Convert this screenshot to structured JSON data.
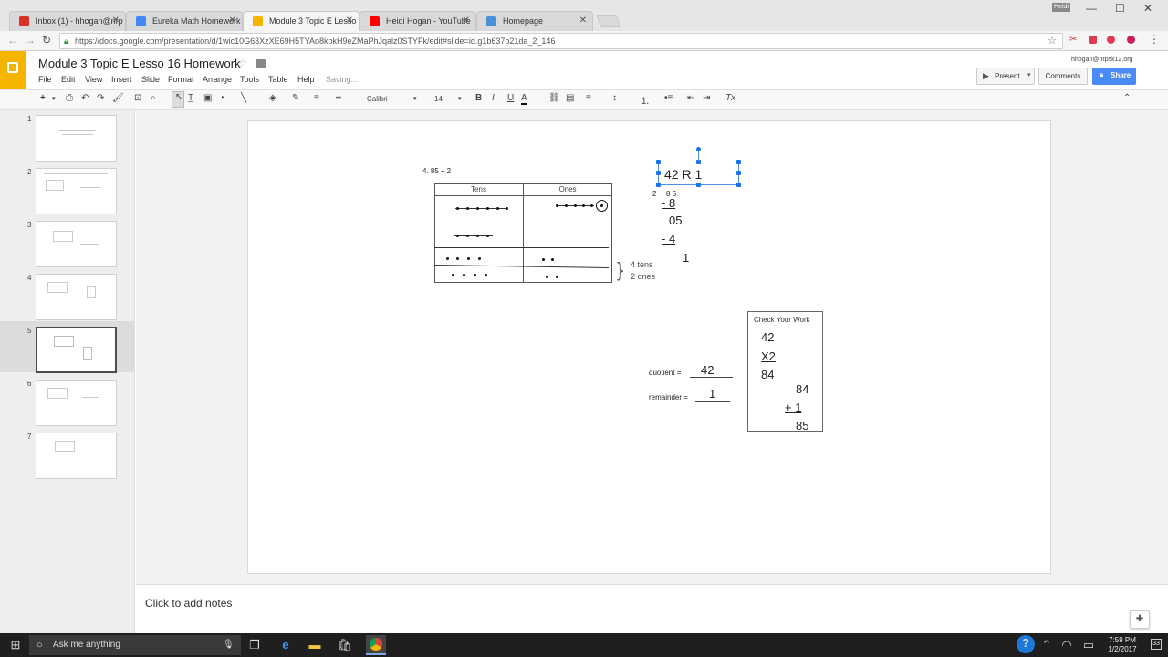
{
  "browser": {
    "tabs": [
      {
        "label": "Inbox (1) - hhogan@nrp",
        "color": "#d93025"
      },
      {
        "label": "Eureka Math Homework",
        "color": "#4285f4"
      },
      {
        "label": "Module 3 Topic E Lesso",
        "color": "#f4b400"
      },
      {
        "label": "Heidi Hogan - YouTube",
        "color": "#ff0000"
      },
      {
        "label": "Homepage",
        "color": "#4a90d9"
      }
    ],
    "profile_label": "Heidi",
    "url": "https://docs.google.com/presentation/d/1wic10G63XzXE69H5TYAo8kbkH9eZMaPhJqalz0STYFk/edit#slide=id.g1b637b21da_2_146"
  },
  "doc": {
    "title": "Module 3 Topic E Lesso 16 Homework",
    "menus": [
      "File",
      "Edit",
      "View",
      "Insert",
      "Slide",
      "Format",
      "Arrange",
      "Tools",
      "Table",
      "Help"
    ],
    "status": "Saving...",
    "account": "hhogan@nrpsk12.org",
    "present_label": "Present",
    "comments_label": "Comments",
    "share_label": "Share",
    "font_name": "Calibri",
    "font_size": "14"
  },
  "filmstrip": {
    "slides": [
      "1",
      "2",
      "3",
      "4",
      "5",
      "6",
      "7"
    ],
    "selected": "5"
  },
  "slide": {
    "problem": "4.    85 ÷ 2",
    "table_headers": {
      "tens": "Tens",
      "ones": "Ones"
    },
    "brace_lines": [
      "4 tens",
      "2 ones"
    ],
    "answer_box": "42 R 1",
    "division_divisor": "2",
    "division_dividend": "8 5",
    "division_steps": [
      "- 8",
      "05",
      "-  4",
      "1"
    ],
    "quotient_label": "quotient =",
    "quotient_value": "42",
    "remainder_label": "remainder =",
    "remainder_value": "1",
    "check_title": "Check Your Work",
    "check_lines": [
      "42",
      "X2",
      "84",
      "84",
      "+  1",
      "85"
    ]
  },
  "notes_placeholder": "Click to add notes",
  "taskbar": {
    "search_placeholder": "Ask me anything",
    "time": "7:59 PM",
    "date": "1/2/2017",
    "notifications": "33"
  }
}
